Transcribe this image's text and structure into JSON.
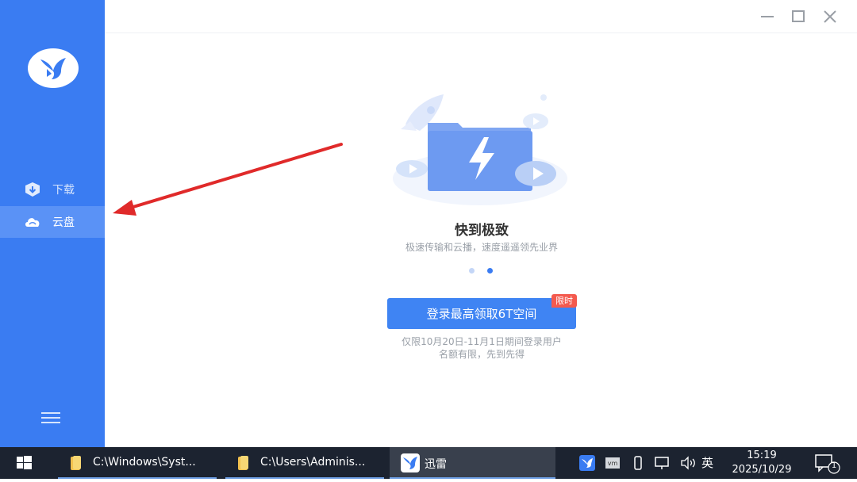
{
  "sidebar": {
    "items": [
      {
        "label": "下载",
        "icon": "download-icon"
      },
      {
        "label": "云盘",
        "icon": "cloud-icon",
        "selected": true
      }
    ],
    "menu_icon": "hamburger-icon"
  },
  "window_controls": [
    "minimize-icon",
    "maximize-icon",
    "close-icon"
  ],
  "main": {
    "headline": "快到极致",
    "subline": "极速传输和云播，速度遥遥领先业界",
    "carousel": {
      "count": 2,
      "active": 2
    },
    "login_button": "登录最高领取6T空间",
    "badge": "限时",
    "note_line1": "仅限10月20日-11月1日期间登录用户",
    "note_line2": "名额有限，先到先得"
  },
  "annotation": {
    "type": "arrow",
    "color": "#e02a2a"
  },
  "taskbar": {
    "tasks": [
      {
        "label": "C:\\Windows\\Syst...",
        "icon": "folder-icon"
      },
      {
        "label": "C:\\Users\\Adminis...",
        "icon": "folder-icon"
      },
      {
        "label": "迅雷",
        "icon": "thunder-bird-icon",
        "active": true
      }
    ],
    "ime": "英",
    "time": "15:19",
    "date": "2025/10/29",
    "notification_count": "1"
  },
  "colors": {
    "accent": "#3a7cf2",
    "badge": "#f45a4e",
    "taskbar": "#1c2330"
  }
}
